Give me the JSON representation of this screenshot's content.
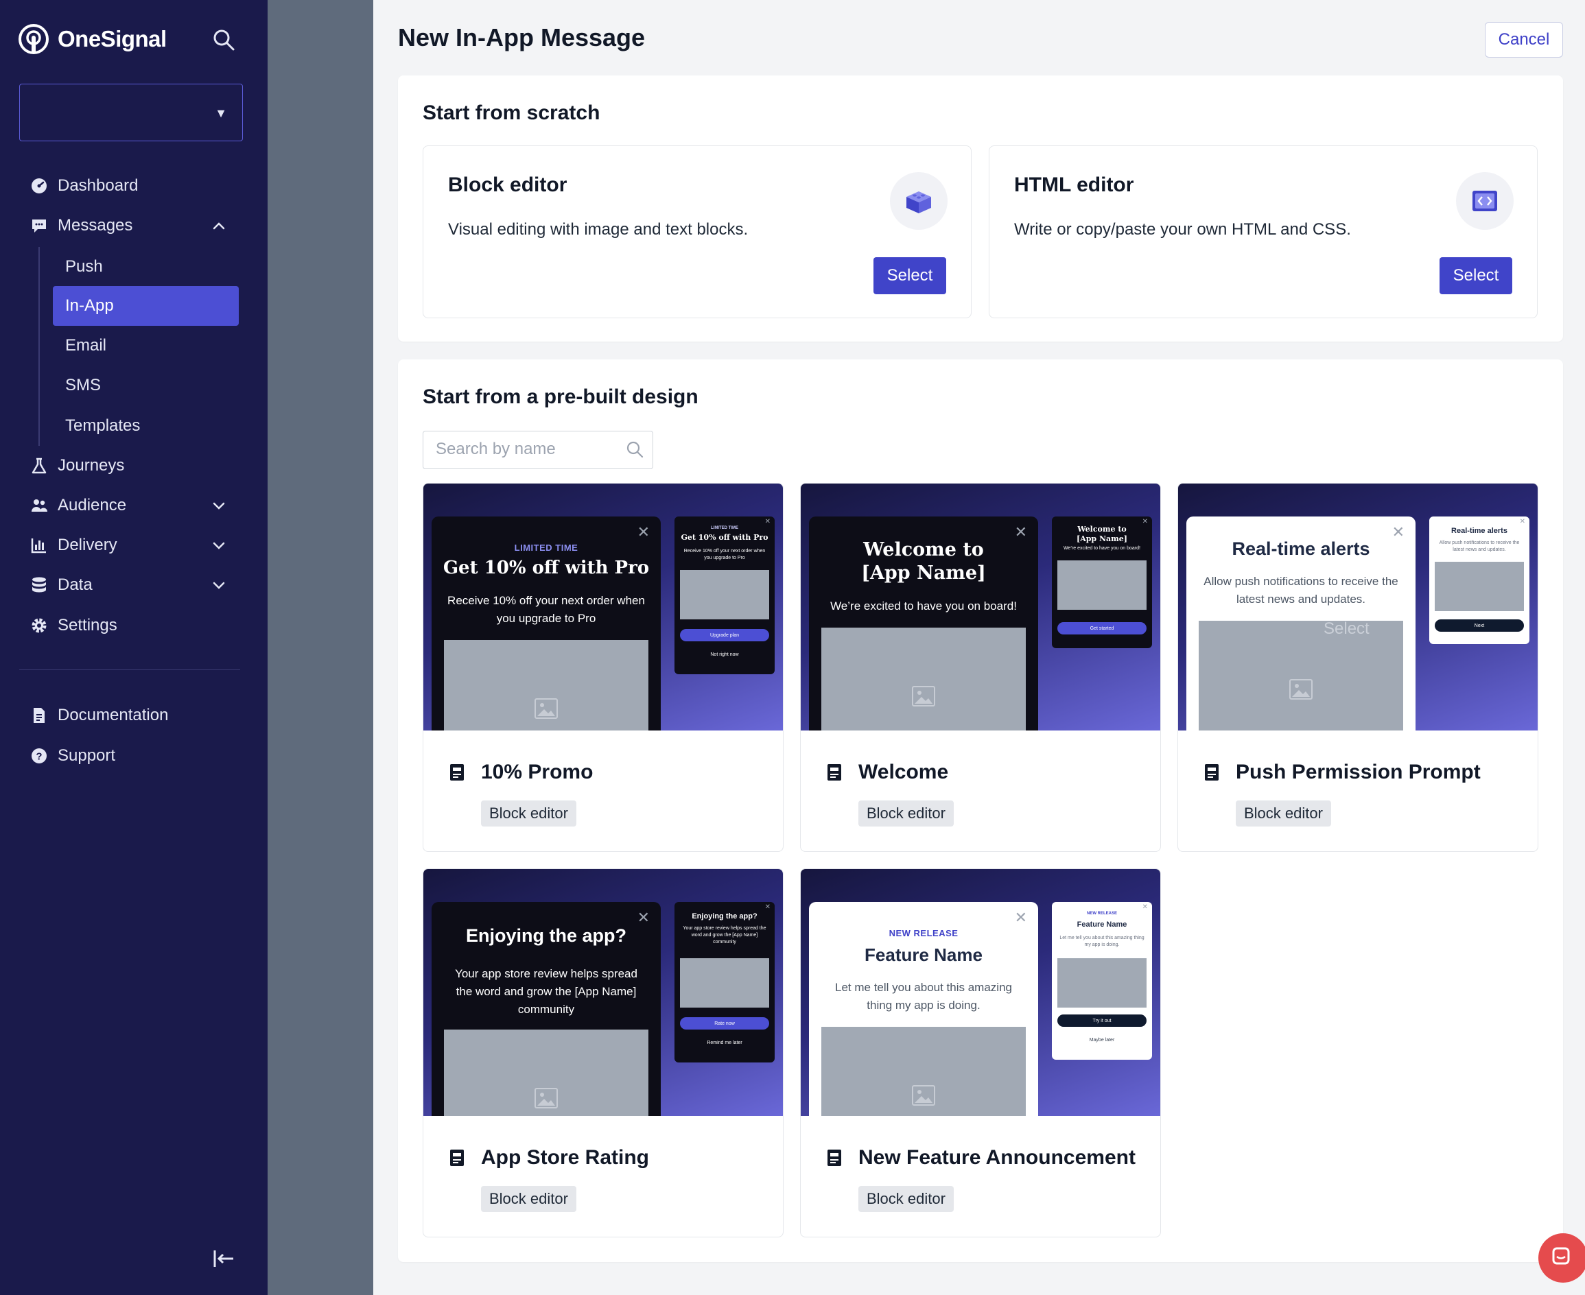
{
  "app": {
    "brand": "OneSignal",
    "app_selector_value": ""
  },
  "sidebar": {
    "nav": [
      {
        "label": "Dashboard",
        "icon": "dashboard-icon"
      },
      {
        "label": "Messages",
        "icon": "messages-icon",
        "expanded": true
      },
      {
        "label": "Journeys",
        "icon": "journeys-icon"
      },
      {
        "label": "Audience",
        "icon": "audience-icon",
        "expanded": false
      },
      {
        "label": "Delivery",
        "icon": "delivery-icon",
        "expanded": false
      },
      {
        "label": "Data",
        "icon": "data-icon",
        "expanded": false
      },
      {
        "label": "Settings",
        "icon": "settings-icon"
      }
    ],
    "messages_sub": [
      {
        "label": "Push"
      },
      {
        "label": "In-App",
        "active": true
      },
      {
        "label": "Email"
      },
      {
        "label": "SMS"
      },
      {
        "label": "Templates"
      }
    ],
    "footer": [
      {
        "label": "Documentation",
        "icon": "document-icon"
      },
      {
        "label": "Support",
        "icon": "help-icon"
      }
    ]
  },
  "page": {
    "title": "New In-App Message",
    "cancel_label": "Cancel"
  },
  "scratch": {
    "title": "Start from scratch",
    "cards": [
      {
        "title": "Block editor",
        "desc": "Visual editing with image and text blocks.",
        "button": "Select",
        "icon": "blocks-icon"
      },
      {
        "title": "HTML editor",
        "desc": "Write or copy/paste your own HTML and CSS.",
        "button": "Select",
        "icon": "code-icon"
      }
    ]
  },
  "prebuilt": {
    "title": "Start from a pre-built design",
    "search_placeholder": "Search by name",
    "templates": [
      {
        "name": "10% Promo",
        "tag": "Block editor",
        "mock": {
          "eyebrow": "LIMITED TIME",
          "head": "Get 10% off with Pro",
          "body": "Receive 10% off your next order when you upgrade to Pro",
          "s_eyebrow": "LIMITED TIME",
          "s_head": "Get 10% off with Pro",
          "s_body": "Receive 10% off your next order when you upgrade to Pro",
          "s_btn": "Upgrade plan",
          "s_link": "Not right now"
        }
      },
      {
        "name": "Welcome",
        "tag": "Block editor",
        "mock": {
          "head": "Welcome to [App Name]",
          "body": "We’re excited to have you on board!",
          "s_head": "Welcome to [App Name]",
          "s_body": "We’re excited to have you on board!",
          "s_btn": "Get started"
        }
      },
      {
        "name": "Push Permission Prompt",
        "tag": "Block editor",
        "mock": {
          "head": "Real-time alerts",
          "body": "Allow push notifications to receive the latest news and updates.",
          "overlay": "Select",
          "s_head": "Real-time alerts",
          "s_body": "Allow push notifications to receive the latest news and updates.",
          "s_btn": "Next"
        }
      },
      {
        "name": "App Store Rating",
        "tag": "Block editor",
        "mock": {
          "head": "Enjoying the app?",
          "body": "Your app store review helps spread the word and grow the [App Name] community",
          "s_head": "Enjoying the app?",
          "s_body": "Your app store review helps spread the word and grow the [App Name] community",
          "s_btn": "Rate now",
          "s_link": "Remind me later"
        }
      },
      {
        "name": "New Feature Announcement",
        "tag": "Block editor",
        "mock": {
          "eyebrow": "NEW RELEASE",
          "head": "Feature Name",
          "body": "Let me tell you about this amazing thing my app is doing.",
          "s_eyebrow": "NEW RELEASE",
          "s_head": "Feature Name",
          "s_body": "Let me tell you about this amazing thing my app is doing.",
          "s_btn": "Try it out",
          "s_link": "Maybe later"
        }
      }
    ]
  },
  "colors": {
    "sidebar_bg": "#1a1a4b",
    "accent": "#4044c9",
    "active_nav": "#4c4fd4",
    "chat_bubble": "#e54b4d"
  }
}
